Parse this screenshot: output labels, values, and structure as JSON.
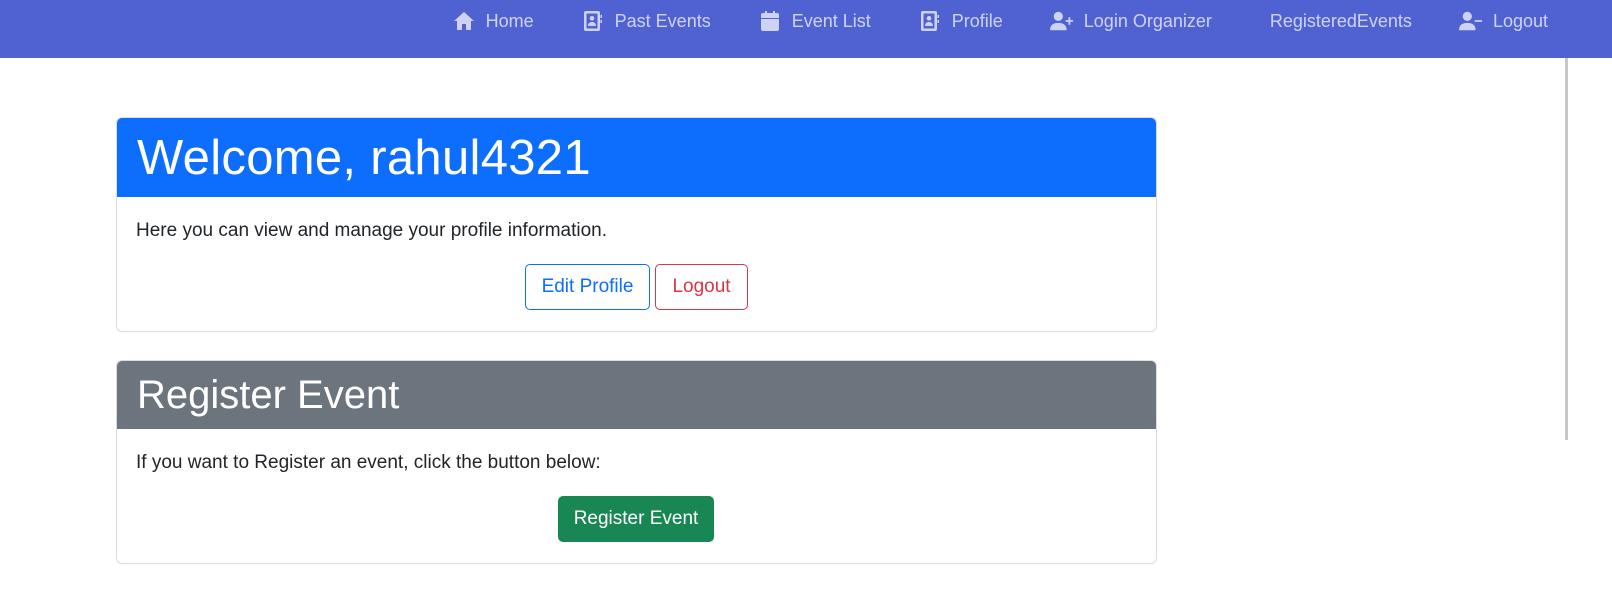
{
  "navbar": {
    "bg_color": "#5061d2",
    "items": [
      {
        "label": "Home",
        "icon": "home-icon"
      },
      {
        "label": "Past Events",
        "icon": "contact-book-icon"
      },
      {
        "label": "Event List",
        "icon": "calendar-icon"
      },
      {
        "label": "Profile",
        "icon": "contact-book-icon"
      },
      {
        "label": "Login Organizer",
        "icon": "user-plus-icon"
      },
      {
        "label": "RegisteredEvents",
        "icon": ""
      },
      {
        "label": "Logout",
        "icon": "user-minus-icon"
      }
    ]
  },
  "welcome_card": {
    "title": "Welcome, rahul4321",
    "header_color": "#0d6efd",
    "text": "Here you can view and manage your profile information.",
    "edit_button": "Edit Profile",
    "logout_button": "Logout"
  },
  "register_card": {
    "title": "Register Event",
    "header_color": "#6c757d",
    "text": "If you want to Register an event, click the button below:",
    "register_button": "Register Event",
    "button_color": "#198754"
  }
}
